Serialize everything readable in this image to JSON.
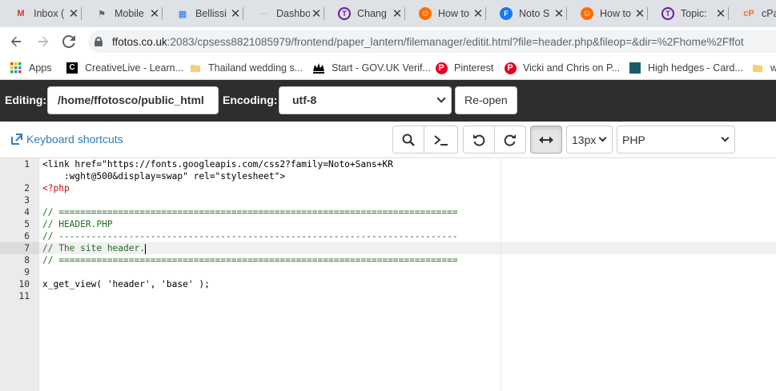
{
  "browser": {
    "tabs": [
      {
        "label": "Inbox (",
        "favicon": "gmail-icon",
        "color": "#d93025",
        "glyph": "M"
      },
      {
        "label": "Mobile",
        "favicon": "mobile-icon",
        "color": "#5f6368",
        "glyph": "⚑"
      },
      {
        "label": "Bellissi",
        "favicon": "bellissi-icon",
        "color": "#1a73e8",
        "glyph": "▦"
      },
      {
        "label": "Dashbo",
        "favicon": "dashboard-icon",
        "color": "#d7c9b4",
        "glyph": "—"
      },
      {
        "label": "Chang",
        "favicon": "topic-t-icon",
        "color": "#6a1b9a",
        "glyph": "T"
      },
      {
        "label": "How to",
        "favicon": "howto-icon",
        "color": "#ff6d00",
        "glyph": "☺"
      },
      {
        "label": "Noto S",
        "favicon": "facebook-icon",
        "color": "#1877f2",
        "glyph": "F"
      },
      {
        "label": "How to",
        "favicon": "howto-icon",
        "color": "#ff6d00",
        "glyph": "☺"
      },
      {
        "label": "Topic:",
        "favicon": "topic-t-icon",
        "color": "#6a1b9a",
        "glyph": "T"
      },
      {
        "label": "cPa",
        "favicon": "cpanel-icon",
        "color": "#ff6c2c",
        "glyph": "cP"
      }
    ],
    "url_host": "ffotos.co.uk",
    "url_rest": ":2083/cpsess8821085979/frontend/paper_lantern/filemanager/editit.html?file=header.php&fileop=&dir=%2Fhome%2Fffot",
    "bookmarks": [
      {
        "label": "Apps",
        "icon": "apps-grid-icon"
      },
      {
        "label": "CreativeLive - Learn...",
        "icon": "creativelive-icon"
      },
      {
        "label": "Thailand wedding s...",
        "icon": "folder-icon"
      },
      {
        "label": "Start - GOV.UK Verif...",
        "icon": "crown-icon"
      },
      {
        "label": "Pinterest",
        "icon": "pinterest-icon"
      },
      {
        "label": "Vicki and Chris on P...",
        "icon": "pinterest-icon"
      },
      {
        "label": "High hedges - Card...",
        "icon": "hedges-icon"
      },
      {
        "label": "w",
        "icon": "folder-icon"
      }
    ]
  },
  "editbar": {
    "editing_label": "Editing:",
    "path_value": "/home/ffotosco/public_html",
    "encoding_label": "Encoding:",
    "encoding_value": "utf-8",
    "reopen_label": "Re-open"
  },
  "editor_toolbar": {
    "keyboard_shortcuts": "Keyboard shortcuts",
    "font_size": "13px",
    "mode": "PHP"
  },
  "code": {
    "line_numbers": [
      "1",
      "",
      "2",
      "3",
      "4",
      "5",
      "6",
      "7",
      "8",
      "9",
      "10",
      "11"
    ],
    "l1a": "<link href=\"https://fonts.googleapis.com/css2?family=Noto+Sans+KR",
    "l1b": "    :wght@500&display=swap\" rel=\"stylesheet\">",
    "l2": "<?php",
    "l4": "// ==========================================================================",
    "l5": "// HEADER.PHP",
    "l6": "// --------------------------------------------------------------------------",
    "l7": "// The site header.",
    "l8": "// ==========================================================================",
    "l10": "x_get_view( 'header', 'base' );"
  }
}
